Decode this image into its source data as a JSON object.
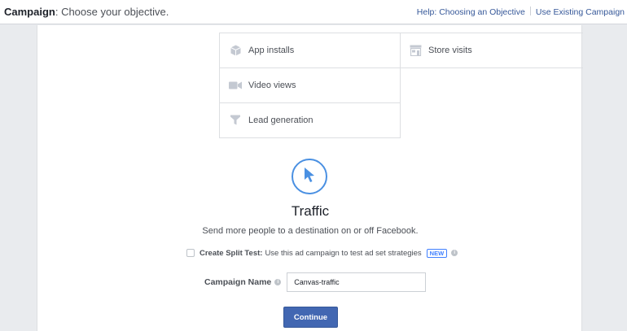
{
  "header": {
    "title_bold": "Campaign",
    "title_rest": ": Choose your objective.",
    "help_link": "Help: Choosing an Objective",
    "existing_link": "Use Existing Campaign"
  },
  "objectives": [
    {
      "label": "App installs",
      "icon": "cube-icon"
    },
    {
      "label": "Store visits",
      "icon": "store-icon"
    },
    {
      "label": "Video views",
      "icon": "video-camera-icon"
    },
    {
      "label": "Lead generation",
      "icon": "funnel-icon"
    }
  ],
  "selected": {
    "icon": "cursor-icon",
    "title": "Traffic",
    "description": "Send more people to a destination on or off Facebook."
  },
  "split_test": {
    "label": "Create Split Test:",
    "text": "Use this ad campaign to test ad set strategies",
    "badge": "NEW",
    "checked": false
  },
  "campaign_name": {
    "label": "Campaign Name",
    "value": "Canvas-traffic"
  },
  "continue_label": "Continue",
  "colors": {
    "accent": "#4a90e2",
    "button": "#4267b2",
    "link": "#365899",
    "background": "#e9ebee"
  }
}
